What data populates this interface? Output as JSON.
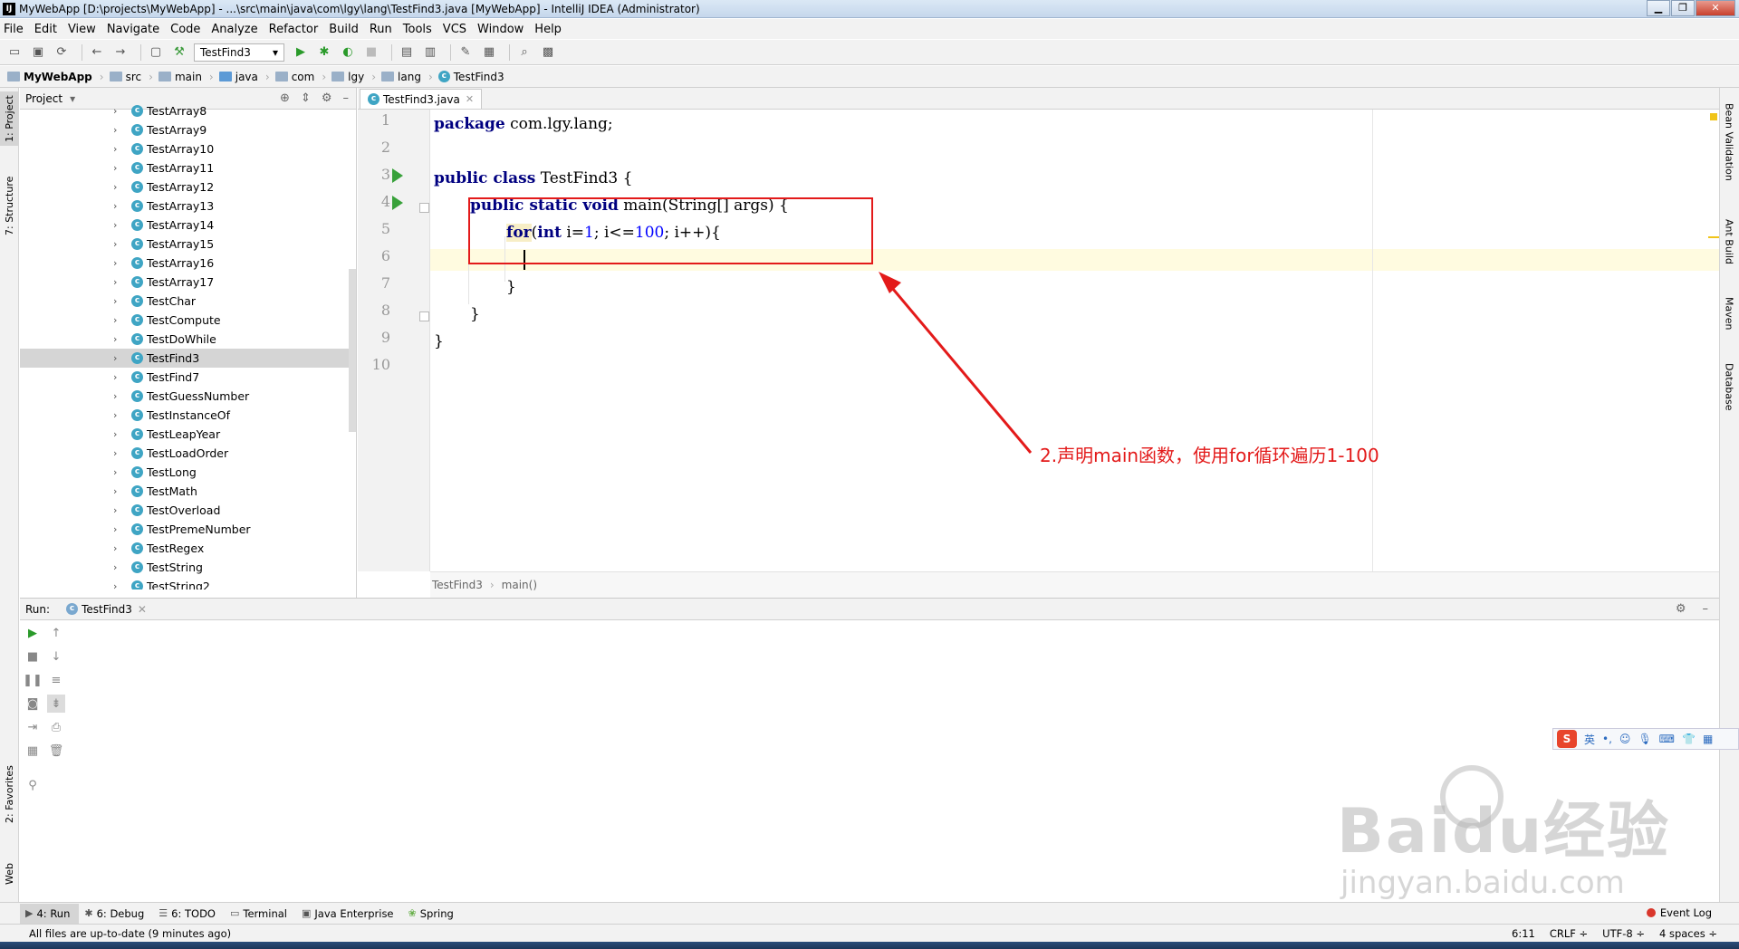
{
  "window": {
    "title": "MyWebApp [D:\\projects\\MyWebApp] - ...\\src\\main\\java\\com\\lgy\\lang\\TestFind3.java [MyWebApp] - IntelliJ IDEA (Administrator)"
  },
  "menu": [
    "File",
    "Edit",
    "View",
    "Navigate",
    "Code",
    "Analyze",
    "Refactor",
    "Build",
    "Run",
    "Tools",
    "VCS",
    "Window",
    "Help"
  ],
  "toolbar": {
    "run_config": "TestFind3"
  },
  "breadcrumb": [
    {
      "label": "MyWebApp",
      "bold": true
    },
    {
      "label": "src"
    },
    {
      "label": "main"
    },
    {
      "label": "java"
    },
    {
      "label": "com"
    },
    {
      "label": "lgy"
    },
    {
      "label": "lang"
    },
    {
      "label": "TestFind3"
    }
  ],
  "left_strip": {
    "project_tab": "1: Project",
    "structure_tab": "7: Structure",
    "favorites_tab": "2: Favorites",
    "web_tab": "Web"
  },
  "right_strip": {
    "bean_validation": "Bean Validation",
    "ant_build": "Ant Build",
    "maven": "Maven",
    "database": "Database"
  },
  "project_panel": {
    "title": "Project",
    "items": [
      "TestArray8",
      "TestArray9",
      "TestArray10",
      "TestArray11",
      "TestArray12",
      "TestArray13",
      "TestArray14",
      "TestArray15",
      "TestArray16",
      "TestArray17",
      "TestChar",
      "TestCompute",
      "TestDoWhile",
      "TestFind3",
      "TestFind7",
      "TestGuessNumber",
      "TestInstanceOf",
      "TestLeapYear",
      "TestLoadOrder",
      "TestLong",
      "TestMath",
      "TestOverload",
      "TestPremeNumber",
      "TestRegex",
      "TestString",
      "TestString2"
    ],
    "selected": "TestFind3"
  },
  "editor": {
    "tab": "TestFind3.java",
    "line_numbers": [
      "1",
      "2",
      "3",
      "4",
      "5",
      "6",
      "7",
      "8",
      "9",
      "10"
    ],
    "code": {
      "l1_kw": "package",
      "l1_rest": " com.lgy.lang;",
      "l3_kw": "public class",
      "l3_rest": " TestFind3 {",
      "l4_kw": "public static void",
      "l4_rest": " main(String[] args) {",
      "l5_kw": "for",
      "l5_a": "(",
      "l5_kw2": "int",
      "l5_b": " i=",
      "l5_n1": "1",
      "l5_c": "; i<=",
      "l5_n2": "100",
      "l5_d": "; i++){",
      "l7": "}",
      "l8": "}",
      "l9": "}"
    },
    "breadcrumb_class": "TestFind3",
    "breadcrumb_method": "main()"
  },
  "annotation": "2.声明main函数，使用for循环遍历1-100",
  "run_panel": {
    "label": "Run:",
    "tab": "TestFind3"
  },
  "bottom_tabs": [
    {
      "label": "4: Run",
      "icon": "▶"
    },
    {
      "label": "6: Debug",
      "icon": "✱"
    },
    {
      "label": "6: TODO",
      "icon": "☰"
    },
    {
      "label": "Terminal",
      "icon": "▭"
    },
    {
      "label": "Java Enterprise",
      "icon": "▣"
    },
    {
      "label": "Spring",
      "icon": "❀"
    }
  ],
  "event_log": "Event Log",
  "status": {
    "message": "All files are up-to-date (9 minutes ago)",
    "position": "6:11",
    "line_sep": "CRLF ÷",
    "encoding": "UTF-8 ÷",
    "indent": "4 spaces ÷"
  },
  "ime": {
    "lang": "英"
  },
  "watermark": {
    "big": "Baidu经验",
    "small": "jingyan.baidu.com"
  }
}
